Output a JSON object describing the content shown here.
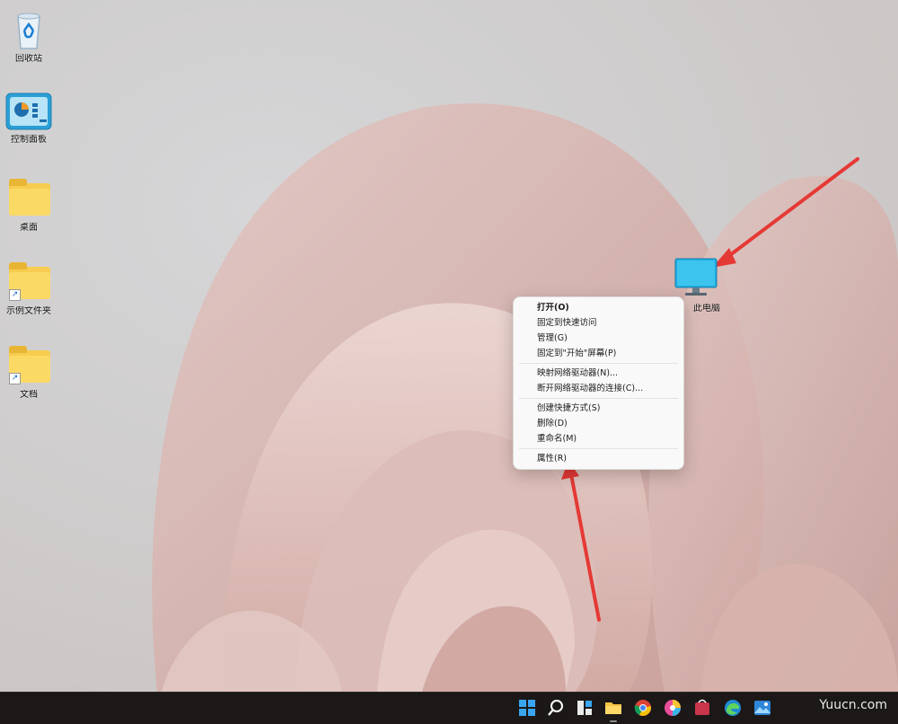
{
  "desktop_icons": [
    {
      "id": "recycle-bin",
      "label": "回收站"
    },
    {
      "id": "control-panel",
      "label": "控制面板"
    },
    {
      "id": "desktop-folder",
      "label": "桌面"
    },
    {
      "id": "shared-folder",
      "label": "示例文件夹"
    },
    {
      "id": "documents",
      "label": "文档"
    },
    {
      "id": "this-pc",
      "label": "此电脑"
    }
  ],
  "context_menu": {
    "items": [
      {
        "label": "打开(O)"
      },
      {
        "label": "固定到快速访问"
      },
      {
        "label": "管理(G)"
      },
      {
        "label": "固定到\"开始\"屏幕(P)"
      },
      {
        "label": "映射网络驱动器(N)..."
      },
      {
        "label": "断开网络驱动器的连接(C)..."
      },
      {
        "label": "创建快捷方式(S)"
      },
      {
        "label": "删除(D)"
      },
      {
        "label": "重命名(M)"
      },
      {
        "label": "属性(R)"
      }
    ]
  },
  "taskbar": {
    "icons": [
      "windows-start-icon",
      "search-icon",
      "task-view-icon",
      "file-explorer-icon",
      "chrome-icon",
      "color-app-icon",
      "store-app-icon",
      "edge-icon",
      "photos-icon"
    ],
    "watermark": "Yuucn.com"
  },
  "colors": {
    "accent": "#e53935",
    "taskbar": "#1c1818"
  }
}
